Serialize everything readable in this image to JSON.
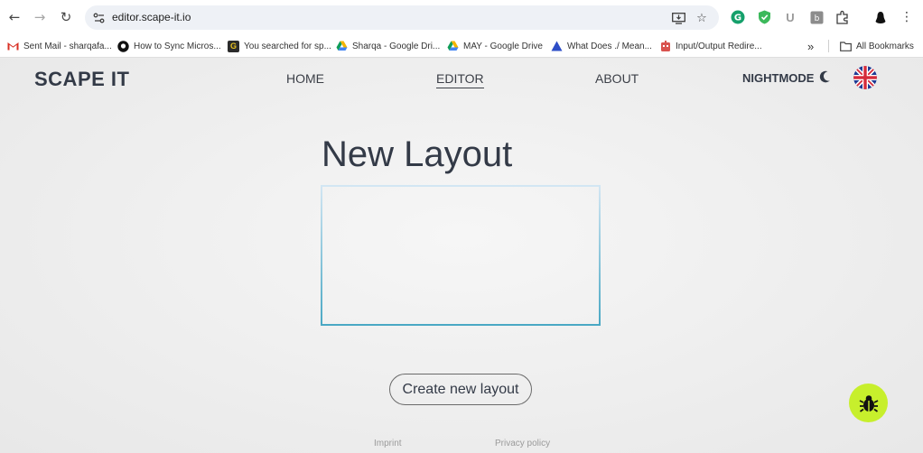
{
  "browser": {
    "url": "editor.scape-it.io",
    "bookmarks": [
      {
        "label": "Sent Mail - sharqafa...",
        "icon": "gmail-icon"
      },
      {
        "label": "How to Sync Micros...",
        "icon": "github-icon"
      },
      {
        "label": "You searched for sp...",
        "icon": "g-icon"
      },
      {
        "label": "Sharqa - Google Dri...",
        "icon": "google-drive-icon"
      },
      {
        "label": "MAY - Google Drive",
        "icon": "google-drive-icon"
      },
      {
        "label": "What Does ./ Mean...",
        "icon": "triangle-icon"
      },
      {
        "label": "Input/Output Redire...",
        "icon": "robot-icon"
      }
    ],
    "more_bookmarks": "»",
    "all_bookmarks": "All Bookmarks"
  },
  "header": {
    "brand": "SCAPE IT",
    "nav": [
      {
        "label": "HOME"
      },
      {
        "label": "EDITOR"
      },
      {
        "label": "ABOUT"
      }
    ],
    "nightmode": "NIGHTMODE"
  },
  "main": {
    "title": "New Layout",
    "create_button": "Create new layout"
  },
  "footer": {
    "imprint": "Imprint",
    "privacy": "Privacy policy"
  },
  "colors": {
    "accent": "#c7ef2c",
    "text": "#333a47",
    "box_border": "#4aa8c4"
  }
}
